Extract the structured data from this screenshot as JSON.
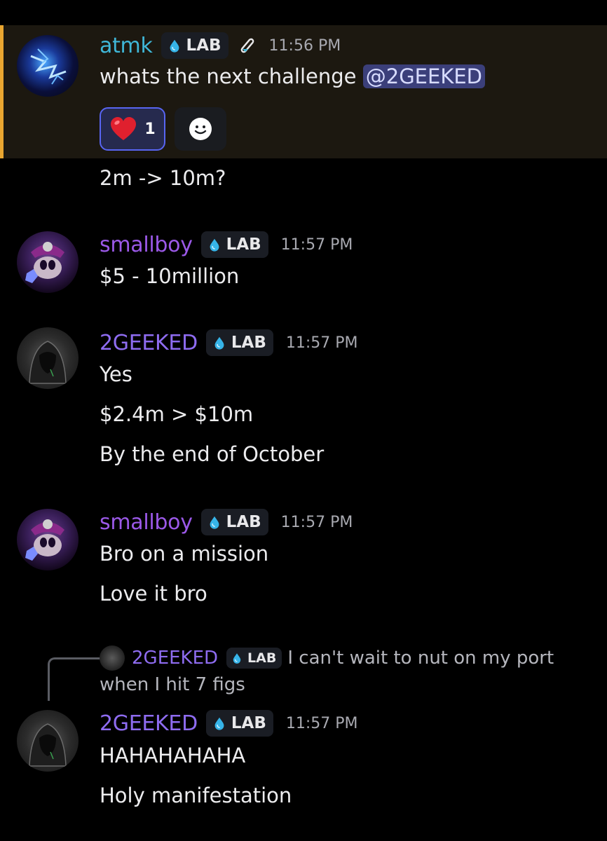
{
  "messages": [
    {
      "username": "atmk",
      "username_color": "#3fb7d8",
      "tag": "LAB",
      "time": "11:56 PM",
      "line1_prefix": "whats the next challenge ",
      "mention": "@2GEEKED",
      "reaction_count": "1",
      "line2": "2m -> 10m?"
    },
    {
      "username": "smallboy",
      "username_color": "#9b59e8",
      "tag": "LAB",
      "time": "11:57 PM",
      "lines": [
        "$5 - 10million"
      ]
    },
    {
      "username": "2GEEKED",
      "username_color": "#8e6cf0",
      "tag": "LAB",
      "time": "11:57 PM",
      "lines": [
        "Yes",
        "$2.4m > $10m",
        "By the end of October"
      ]
    },
    {
      "username": "smallboy",
      "username_color": "#9b59e8",
      "tag": "LAB",
      "time": "11:57 PM",
      "lines": [
        "Bro on a mission",
        "Love it bro"
      ]
    },
    {
      "reply": {
        "username": "2GEEKED",
        "tag": "LAB",
        "text_line1": "I can't wait to nut on my port",
        "text_line2": "when I hit 7 figs"
      },
      "username": "2GEEKED",
      "username_color": "#8e6cf0",
      "tag": "LAB",
      "time": "11:57 PM",
      "lines": [
        "HAHAHAHAHA",
        "Holy manifestation"
      ]
    }
  ],
  "icons": {
    "tag_icon": "water-drop-icon",
    "role_icon": "test-tube-icon",
    "reaction_emoji": "heart-icon",
    "add_reaction": "smiley-icon"
  },
  "colors": {
    "highlight_bg": "#1c1810",
    "highlight_border": "#e9a630",
    "mention_bg": "#3b3f7a",
    "reaction_border": "#5865f2"
  }
}
